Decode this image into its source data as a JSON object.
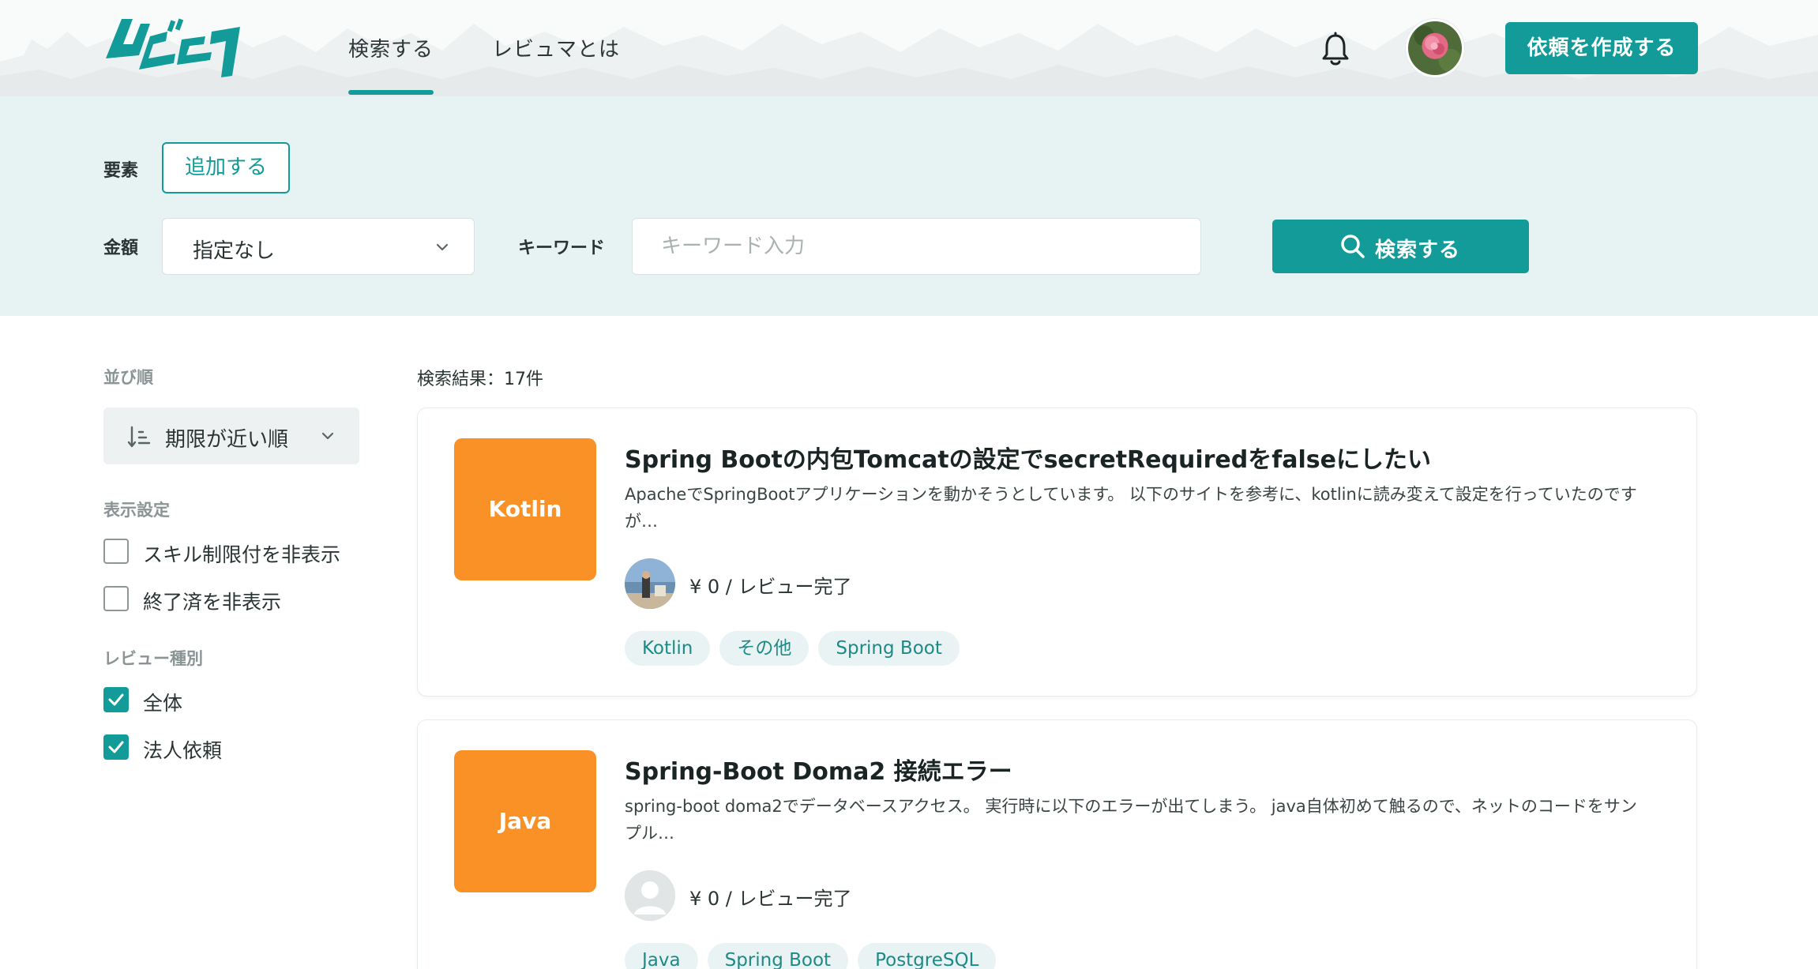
{
  "colors": {
    "accent": "#129b98",
    "thumb_orange": "#fa9127",
    "panel_bg": "#e7f3f3"
  },
  "header": {
    "logo_icon": "revyuma-logo",
    "tabs": [
      {
        "label": "検索する",
        "active": true
      },
      {
        "label": "レビュマとは",
        "active": false
      }
    ],
    "notification_icon": "bell-icon",
    "create_button": "依頼を作成する"
  },
  "search": {
    "element_label": "要素",
    "add_button": "追加する",
    "amount_label": "金額",
    "amount_value": "指定なし",
    "keyword_label": "キーワード",
    "keyword_placeholder": "キーワード入力",
    "keyword_value": "",
    "search_button": "検索する"
  },
  "sidebar": {
    "sort_heading": "並び順",
    "sort_value": "期限が近い順",
    "display_heading": "表示設定",
    "display_options": [
      {
        "label": "スキル制限付を非表示",
        "checked": false
      },
      {
        "label": "終了済を非表示",
        "checked": false
      }
    ],
    "review_type_heading": "レビュー種別",
    "review_types": [
      {
        "label": "全体",
        "checked": true
      },
      {
        "label": "法人依頼",
        "checked": true
      }
    ]
  },
  "results": {
    "count_text": "検索結果：17件",
    "items": [
      {
        "thumb_label": "Kotlin",
        "title": "Spring Bootの内包Tomcatの設定でsecretRequiredをfalseにしたい",
        "description": "ApacheでSpringBootアプリケーションを動かそうとしています。 以下のサイトを参考に、kotlinに読み変えて設定を行っていたのですが…",
        "price_status": "¥ 0 / レビュー完了",
        "tags": [
          "Kotlin",
          "その他",
          "Spring Boot"
        ]
      },
      {
        "thumb_label": "Java",
        "title": "Spring-Boot Doma2 接続エラー",
        "description": "spring-boot doma2でデータベースアクセス。 実行時に以下のエラーが出てしまう。 java自体初めて触るので、ネットのコードをサンプル…",
        "price_status": "¥ 0 / レビュー完了",
        "tags": [
          "Java",
          "Spring Boot",
          "PostgreSQL"
        ]
      }
    ]
  }
}
